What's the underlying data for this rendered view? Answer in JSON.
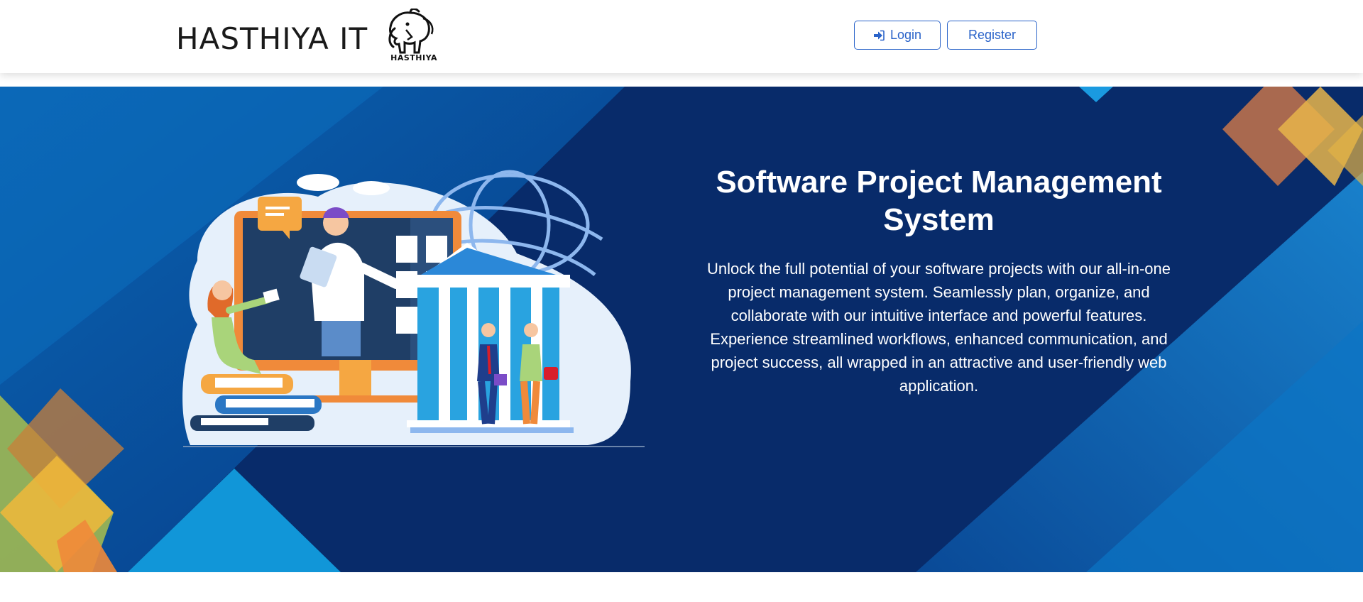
{
  "navbar": {
    "brand_text": "HASTHIYA IT",
    "logo_caption": "HASTHIYA",
    "login_label": "Login",
    "register_label": "Register",
    "accent_color": "#2a63c9"
  },
  "hero": {
    "title": "Software Project Management System",
    "description": "Unlock the full potential of your software projects with our all-in-one project management system. Seamlessly plan, organize, and collaborate with our intuitive interface and powerful features. Experience streamlined workflows, enhanced communication, and project success, all wrapped in an attractive and user-friendly web application.",
    "background_color": "#0a2c6b",
    "illustration_icon": "online-education-illustration"
  }
}
